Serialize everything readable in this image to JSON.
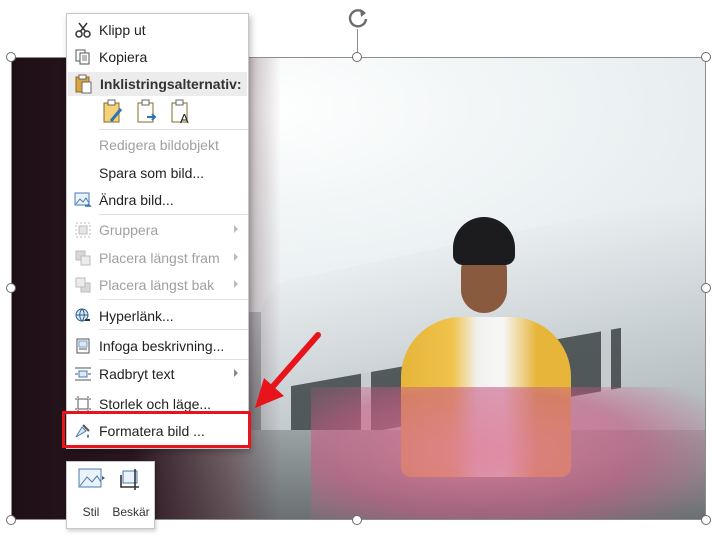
{
  "menu": {
    "cut": "Klipp ut",
    "copy": "Kopiera",
    "paste_header": "Inklistringsalternativ:",
    "edit_image": "Redigera bildobjekt",
    "save_as_image": "Spara som bild...",
    "change_image": "Ändra bild...",
    "group": "Gruppera",
    "bring_front": "Placera längst fram",
    "send_back": "Placera längst bak",
    "hyperlink": "Hyperlänk...",
    "insert_caption": "Infoga beskrivning...",
    "wrap_text": "Radbryt text",
    "size_position": "Storlek och läge...",
    "format_image": "Formatera bild ..."
  },
  "mini_toolbar": {
    "style": "Stil",
    "crop": "Beskär"
  },
  "colors": {
    "highlight": "#e8141c",
    "accent_blue": "#2e75b6"
  }
}
